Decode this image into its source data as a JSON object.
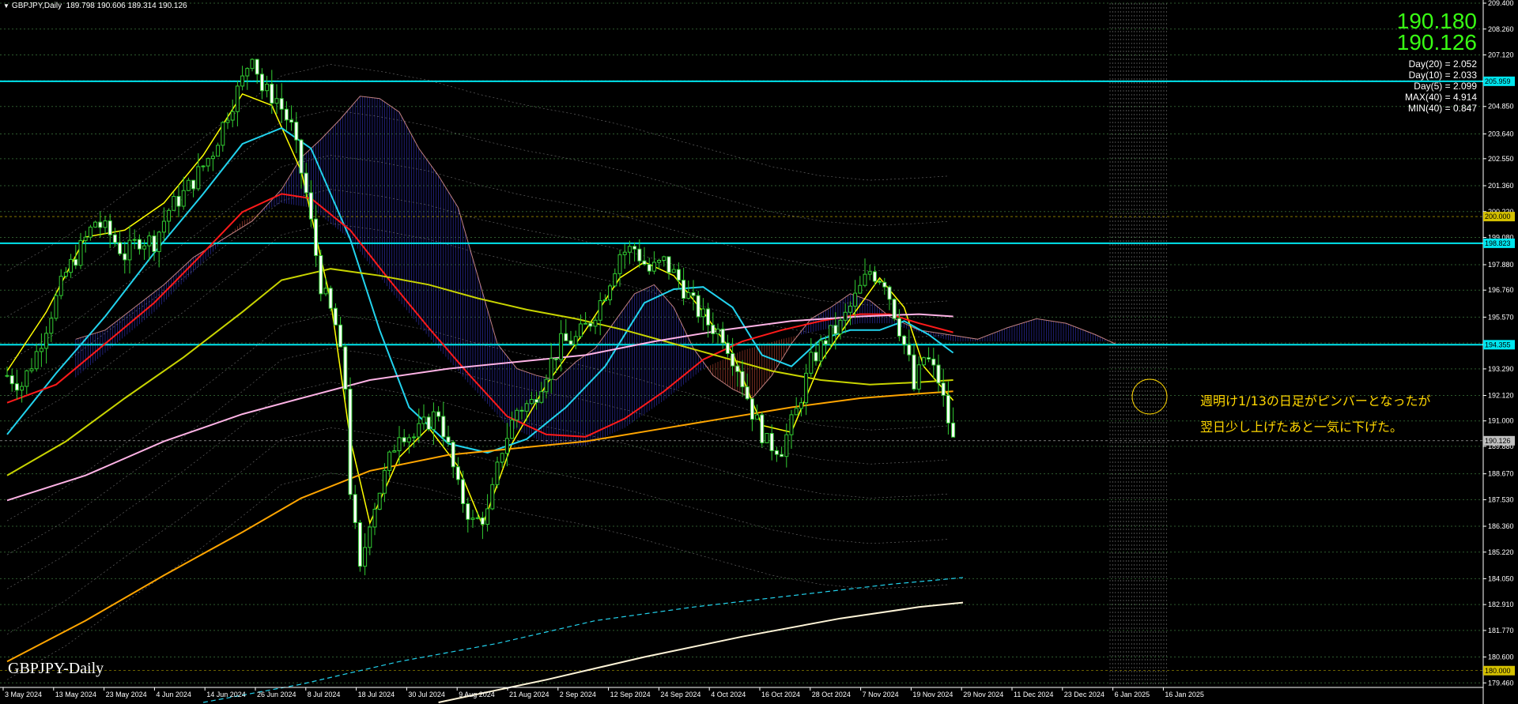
{
  "header": {
    "symbol": "GBPJPY,Daily",
    "ohlc": "189.798 190.606 189.314 190.126"
  },
  "quote": {
    "bid": "190.180",
    "ask": "190.126"
  },
  "stats": [
    "Day(20) = 2.052",
    "Day(10) = 2.033",
    "Day(5) = 2.099",
    "MAX(40) = 4.914",
    "MIN(40) = 0.847"
  ],
  "annotation": {
    "line1": "週明け1/13の日足がピンバーとなったが",
    "line2": "翌日少し上げたあと一気に下げた。"
  },
  "watermark": "GBPJPY-Daily",
  "colors": {
    "background": "#000000",
    "candle": "#32cd32",
    "hline": "#00e5ee",
    "ma_yellow": "#ffff00",
    "ma_cyan": "#22d3ee",
    "ma_red": "#ff1a1a",
    "ma_olive": "#c8d400",
    "ma_pink": "#ffb3e6",
    "ma_orange": "#ffa500",
    "cloud_up": "#3b3bd6",
    "cloud_down": "#d6503b",
    "annotation": "#ffd700"
  },
  "chart_data": {
    "type": "candlestick",
    "y_axis_ticks": [
      "209.400",
      "208.260",
      "207.120",
      "205.980",
      "204.850",
      "203.640",
      "202.550",
      "201.360",
      "200.220",
      "199.080",
      "197.880",
      "196.760",
      "195.570",
      "194.430",
      "193.290",
      "192.120",
      "191.000",
      "189.880",
      "188.670",
      "187.530",
      "186.360",
      "185.220",
      "184.050",
      "182.910",
      "181.770",
      "180.600",
      "179.460"
    ],
    "y_range": [
      179.4,
      209.4
    ],
    "x_axis_labels": [
      "3 May 2024",
      "13 May 2024",
      "23 May 2024",
      "4 Jun 2024",
      "14 Jun 2024",
      "26 Jun 2024",
      "8 Jul 2024",
      "18 Jul 2024",
      "30 Jul 2024",
      "9 Aug 2024",
      "21 Aug 2024",
      "2 Sep 2024",
      "12 Sep 2024",
      "24 Sep 2024",
      "4 Oct 2024",
      "16 Oct 2024",
      "28 Oct 2024",
      "7 Nov 2024",
      "19 Nov 2024",
      "29 Nov 2024",
      "11 Dec 2024",
      "23 Dec 2024",
      "6 Jan 2025",
      "16 Jan 2025"
    ],
    "horizontal_lines": [
      {
        "label": "205.959",
        "value": 205.959
      },
      {
        "label": "198.823",
        "value": 198.823
      },
      {
        "label": "194.355",
        "value": 194.355
      }
    ],
    "price_tags": [
      {
        "label": "200.000",
        "value": 200.0
      },
      {
        "label": "190.126",
        "value": 190.126
      },
      {
        "label": "180.000",
        "value": 180.0
      }
    ],
    "close_path": [
      [
        0,
        193.0
      ],
      [
        3,
        192.6
      ],
      [
        6,
        194.0
      ],
      [
        9,
        195.8
      ],
      [
        12,
        197.5
      ],
      [
        15,
        198.6
      ],
      [
        18,
        199.8
      ],
      [
        21,
        199.2
      ],
      [
        24,
        198.3
      ],
      [
        27,
        199.0
      ],
      [
        30,
        198.9
      ],
      [
        33,
        200.3
      ],
      [
        36,
        201.0
      ],
      [
        39,
        201.9
      ],
      [
        42,
        202.9
      ],
      [
        45,
        204.6
      ],
      [
        48,
        206.0
      ],
      [
        50,
        207.3
      ],
      [
        52,
        205.6
      ],
      [
        55,
        205.2
      ],
      [
        58,
        203.9
      ],
      [
        61,
        201.0
      ],
      [
        64,
        197.0
      ],
      [
        67,
        195.2
      ],
      [
        69,
        192.5
      ],
      [
        70,
        188.0
      ],
      [
        72,
        184.3
      ],
      [
        74,
        186.7
      ],
      [
        77,
        188.6
      ],
      [
        80,
        190.6
      ],
      [
        83,
        190.3
      ],
      [
        86,
        191.0
      ],
      [
        88,
        191.4
      ],
      [
        90,
        189.8
      ],
      [
        92,
        188.0
      ],
      [
        95,
        186.5
      ],
      [
        98,
        186.9
      ],
      [
        101,
        189.8
      ],
      [
        104,
        191.5
      ],
      [
        107,
        191.8
      ],
      [
        110,
        193.2
      ],
      [
        113,
        194.4
      ],
      [
        116,
        194.6
      ],
      [
        119,
        195.4
      ],
      [
        122,
        196.7
      ],
      [
        125,
        198.4
      ],
      [
        128,
        198.6
      ],
      [
        131,
        197.6
      ],
      [
        134,
        198.0
      ],
      [
        137,
        197.2
      ],
      [
        140,
        196.1
      ],
      [
        143,
        195.3
      ],
      [
        146,
        194.8
      ],
      [
        149,
        193.4
      ],
      [
        152,
        191.4
      ],
      [
        155,
        190.0
      ],
      [
        158,
        189.8
      ],
      [
        161,
        191.4
      ],
      [
        164,
        193.6
      ],
      [
        167,
        194.6
      ],
      [
        170,
        195.2
      ],
      [
        173,
        196.4
      ],
      [
        176,
        197.6
      ],
      [
        179,
        197.2
      ],
      [
        182,
        195.1
      ],
      [
        184,
        193.6
      ],
      [
        185,
        192.4
      ],
      [
        187,
        193.8
      ],
      [
        188,
        193.6
      ],
      [
        190,
        192.8
      ],
      [
        193,
        190.1
      ]
    ],
    "indicators": [
      {
        "name": "yellow",
        "values": [
          [
            0,
            193.2
          ],
          [
            8,
            195.8
          ],
          [
            16,
            199.1
          ],
          [
            24,
            199.4
          ],
          [
            32,
            200.6
          ],
          [
            40,
            202.7
          ],
          [
            48,
            205.4
          ],
          [
            54,
            204.9
          ],
          [
            60,
            202.0
          ],
          [
            66,
            196.3
          ],
          [
            70,
            190.2
          ],
          [
            74,
            186.5
          ],
          [
            80,
            189.4
          ],
          [
            86,
            190.7
          ],
          [
            92,
            189.0
          ],
          [
            97,
            186.4
          ],
          [
            103,
            190.0
          ],
          [
            110,
            192.6
          ],
          [
            118,
            195.0
          ],
          [
            125,
            197.3
          ],
          [
            130,
            198.0
          ],
          [
            136,
            197.4
          ],
          [
            142,
            195.8
          ],
          [
            148,
            194.0
          ],
          [
            154,
            190.8
          ],
          [
            160,
            190.5
          ],
          [
            166,
            193.6
          ],
          [
            172,
            195.5
          ],
          [
            178,
            197.3
          ],
          [
            183,
            196.0
          ],
          [
            187,
            193.4
          ],
          [
            193,
            191.9
          ]
        ]
      },
      {
        "name": "cyan",
        "values": [
          [
            0,
            190.4
          ],
          [
            10,
            193.1
          ],
          [
            20,
            195.6
          ],
          [
            30,
            198.4
          ],
          [
            40,
            201.0
          ],
          [
            48,
            203.2
          ],
          [
            56,
            203.9
          ],
          [
            62,
            203.0
          ],
          [
            70,
            199.0
          ],
          [
            76,
            195.0
          ],
          [
            82,
            191.6
          ],
          [
            90,
            190.0
          ],
          [
            98,
            189.6
          ],
          [
            106,
            190.2
          ],
          [
            114,
            191.6
          ],
          [
            122,
            193.4
          ],
          [
            130,
            196.2
          ],
          [
            136,
            196.8
          ],
          [
            142,
            196.9
          ],
          [
            148,
            196.0
          ],
          [
            154,
            193.9
          ],
          [
            160,
            193.4
          ],
          [
            166,
            194.6
          ],
          [
            172,
            195.0
          ],
          [
            178,
            195.0
          ],
          [
            183,
            195.4
          ],
          [
            188,
            194.8
          ],
          [
            193,
            194.0
          ]
        ]
      },
      {
        "name": "red",
        "values": [
          [
            0,
            191.8
          ],
          [
            10,
            192.6
          ],
          [
            20,
            194.4
          ],
          [
            30,
            196.2
          ],
          [
            40,
            198.4
          ],
          [
            48,
            200.2
          ],
          [
            56,
            201.0
          ],
          [
            62,
            200.8
          ],
          [
            70,
            199.4
          ],
          [
            78,
            197.2
          ],
          [
            86,
            195.1
          ],
          [
            94,
            193.1
          ],
          [
            102,
            191.2
          ],
          [
            110,
            190.4
          ],
          [
            118,
            190.3
          ],
          [
            126,
            191.1
          ],
          [
            134,
            192.3
          ],
          [
            142,
            193.7
          ],
          [
            150,
            194.5
          ],
          [
            158,
            195.0
          ],
          [
            166,
            195.4
          ],
          [
            174,
            195.7
          ],
          [
            180,
            195.7
          ],
          [
            186,
            195.3
          ],
          [
            193,
            194.9
          ]
        ]
      },
      {
        "name": "olive",
        "values": [
          [
            0,
            188.6
          ],
          [
            12,
            190.1
          ],
          [
            24,
            192.0
          ],
          [
            36,
            193.8
          ],
          [
            48,
            195.8
          ],
          [
            56,
            197.2
          ],
          [
            66,
            197.7
          ],
          [
            76,
            197.4
          ],
          [
            86,
            197.0
          ],
          [
            96,
            196.4
          ],
          [
            106,
            195.9
          ],
          [
            116,
            195.5
          ],
          [
            126,
            195.0
          ],
          [
            136,
            194.4
          ],
          [
            146,
            193.8
          ],
          [
            156,
            193.2
          ],
          [
            166,
            192.8
          ],
          [
            176,
            192.6
          ],
          [
            186,
            192.7
          ],
          [
            193,
            192.8
          ]
        ]
      },
      {
        "name": "pink",
        "values": [
          [
            0,
            187.5
          ],
          [
            16,
            188.6
          ],
          [
            32,
            190.1
          ],
          [
            48,
            191.3
          ],
          [
            60,
            192.0
          ],
          [
            74,
            192.8
          ],
          [
            90,
            193.3
          ],
          [
            104,
            193.6
          ],
          [
            118,
            193.9
          ],
          [
            132,
            194.5
          ],
          [
            146,
            195.0
          ],
          [
            160,
            195.4
          ],
          [
            174,
            195.6
          ],
          [
            186,
            195.7
          ],
          [
            193,
            195.6
          ]
        ]
      },
      {
        "name": "orange",
        "values": [
          [
            0,
            180.4
          ],
          [
            16,
            182.2
          ],
          [
            32,
            184.2
          ],
          [
            48,
            186.1
          ],
          [
            60,
            187.6
          ],
          [
            74,
            188.8
          ],
          [
            90,
            189.5
          ],
          [
            104,
            189.8
          ],
          [
            118,
            190.1
          ],
          [
            132,
            190.6
          ],
          [
            146,
            191.1
          ],
          [
            160,
            191.6
          ],
          [
            174,
            192.0
          ],
          [
            186,
            192.2
          ],
          [
            193,
            192.3
          ]
        ]
      },
      {
        "name": "white_long",
        "values": [
          [
            88,
            178.6
          ],
          [
            110,
            179.6
          ],
          [
            130,
            180.6
          ],
          [
            150,
            181.5
          ],
          [
            170,
            182.3
          ],
          [
            186,
            182.8
          ],
          [
            195,
            183.0
          ]
        ]
      },
      {
        "name": "cyan_dash",
        "values": [
          [
            40,
            178.6
          ],
          [
            60,
            179.4
          ],
          [
            80,
            180.4
          ],
          [
            100,
            181.2
          ],
          [
            120,
            182.2
          ],
          [
            140,
            182.8
          ],
          [
            160,
            183.3
          ],
          [
            180,
            183.8
          ],
          [
            195,
            184.1
          ]
        ]
      }
    ],
    "cloud_a": [
      [
        14,
        194.6
      ],
      [
        20,
        195.0
      ],
      [
        26,
        196.0
      ],
      [
        32,
        197.0
      ],
      [
        38,
        198.2
      ],
      [
        44,
        199.0
      ],
      [
        50,
        199.8
      ],
      [
        56,
        201.2
      ],
      [
        60,
        202.6
      ],
      [
        64,
        203.4
      ],
      [
        68,
        204.3
      ],
      [
        72,
        205.3
      ],
      [
        76,
        205.2
      ],
      [
        80,
        204.6
      ],
      [
        84,
        203.0
      ],
      [
        88,
        201.8
      ],
      [
        92,
        200.4
      ],
      [
        96,
        197.4
      ],
      [
        100,
        194.4
      ],
      [
        104,
        193.3
      ],
      [
        108,
        193.0
      ],
      [
        112,
        192.8
      ],
      [
        116,
        193.6
      ],
      [
        120,
        194.2
      ],
      [
        124,
        195.4
      ],
      [
        128,
        196.6
      ],
      [
        132,
        197.0
      ],
      [
        136,
        196.0
      ],
      [
        140,
        194.2
      ],
      [
        144,
        193.0
      ],
      [
        148,
        192.4
      ],
      [
        152,
        192.0
      ],
      [
        156,
        193.0
      ],
      [
        160,
        194.4
      ],
      [
        164,
        195.5
      ],
      [
        168,
        196.0
      ],
      [
        172,
        196.6
      ],
      [
        176,
        196.3
      ],
      [
        180,
        195.6
      ],
      [
        186,
        195.0
      ],
      [
        192,
        194.8
      ],
      [
        198,
        194.6
      ],
      [
        204,
        195.1
      ],
      [
        210,
        195.5
      ],
      [
        216,
        195.3
      ],
      [
        222,
        194.8
      ],
      [
        226,
        194.4
      ]
    ]
  }
}
